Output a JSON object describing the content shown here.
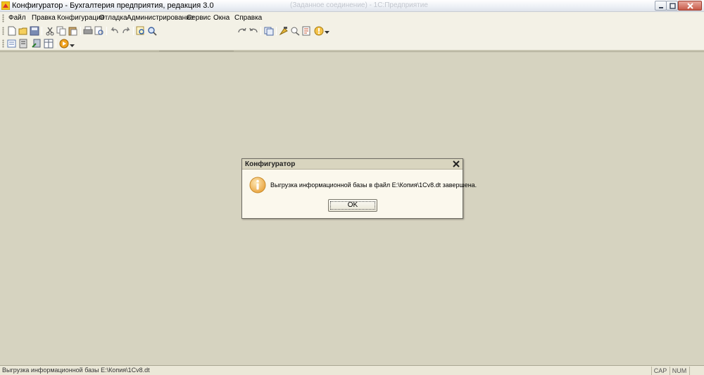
{
  "window": {
    "title": "Конфигуратор - Бухгалтерия предприятия, редакция 3.0",
    "title_suffix_faded": "(Заданное соединение) - 1С:Предприятие"
  },
  "menu": [
    {
      "label": "Файл"
    },
    {
      "label": "Правка"
    },
    {
      "label": "Конфигурация"
    },
    {
      "label": "Отладка"
    },
    {
      "label": "Администрирование"
    },
    {
      "label": "Сервис"
    },
    {
      "label": "Окна"
    },
    {
      "label": "Справка"
    }
  ],
  "toolbar": {
    "search_value": ""
  },
  "dialog": {
    "title": "Конфигуратор",
    "message": "Выгрузка информационной базы в файл E:\\Копия\\1Cv8.dt завершена.",
    "ok_label": "OK",
    "icon": "info-icon"
  },
  "status": {
    "text": "Выгрузка информационной базы E:\\Копия\\1Cv8.dt",
    "cap": "CAP",
    "num": "NUM"
  }
}
